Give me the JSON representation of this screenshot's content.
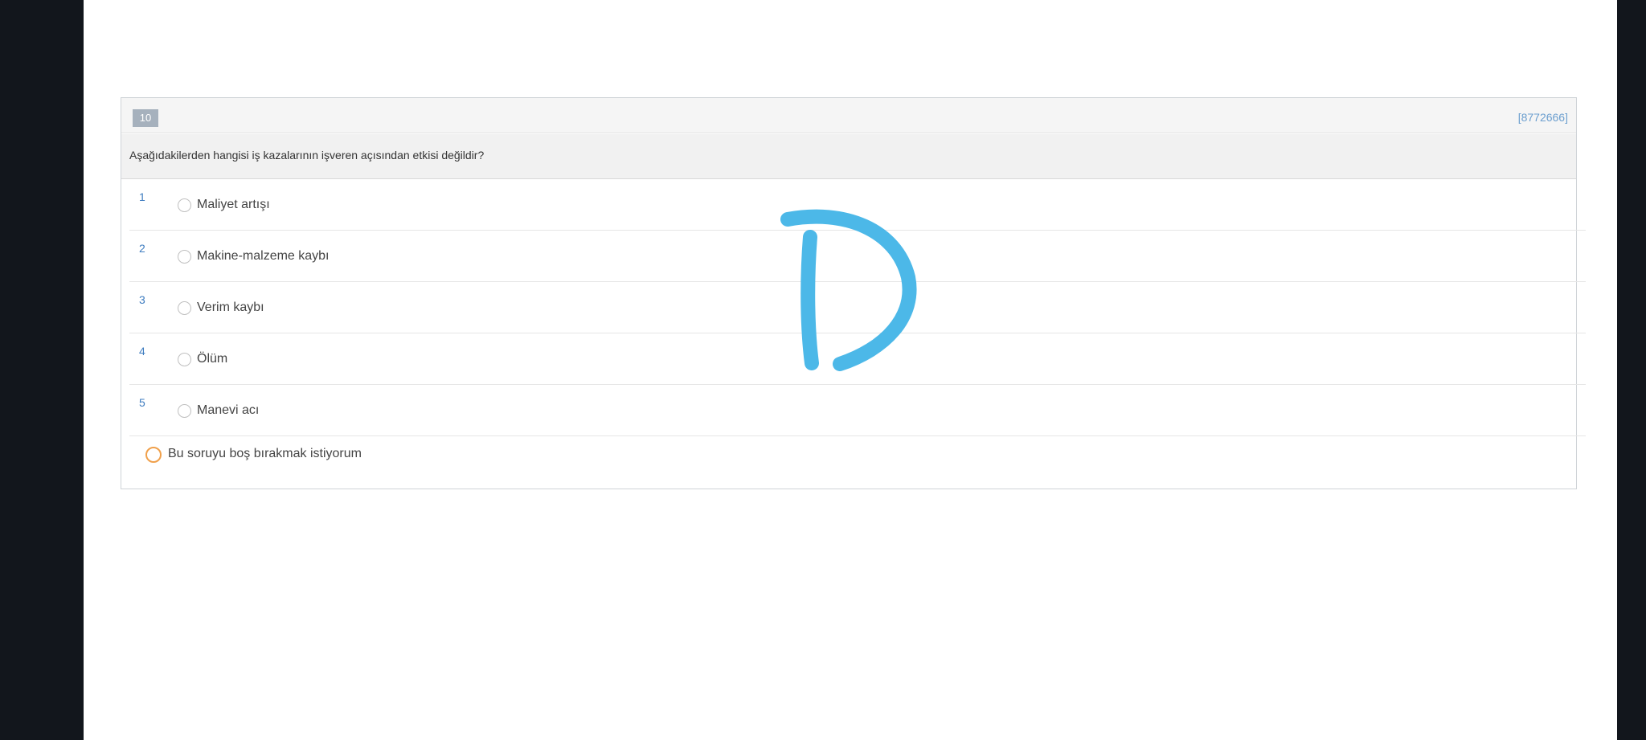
{
  "question": {
    "number": "10",
    "id": "[8772666]",
    "text": "Aşağıdakilerden hangisi iş kazalarının işveren açısından etkisi değildir?"
  },
  "options": [
    {
      "num": "1",
      "label": "Maliyet artışı"
    },
    {
      "num": "2",
      "label": "Makine-malzeme kaybı"
    },
    {
      "num": "3",
      "label": "Verim kaybı"
    },
    {
      "num": "4",
      "label": "Ölüm"
    },
    {
      "num": "5",
      "label": "Manevi acı"
    }
  ],
  "blank_option": {
    "label": "Bu soruyu boş bırakmak istiyorum"
  },
  "annotation": {
    "letter": "D",
    "color": "#4cb8e8"
  },
  "colors": {
    "question_id": "#6c9fcf",
    "option_number": "#3f7dc0",
    "blank_radio": "#f0a04b",
    "number_badge": "#a6b1bd"
  }
}
